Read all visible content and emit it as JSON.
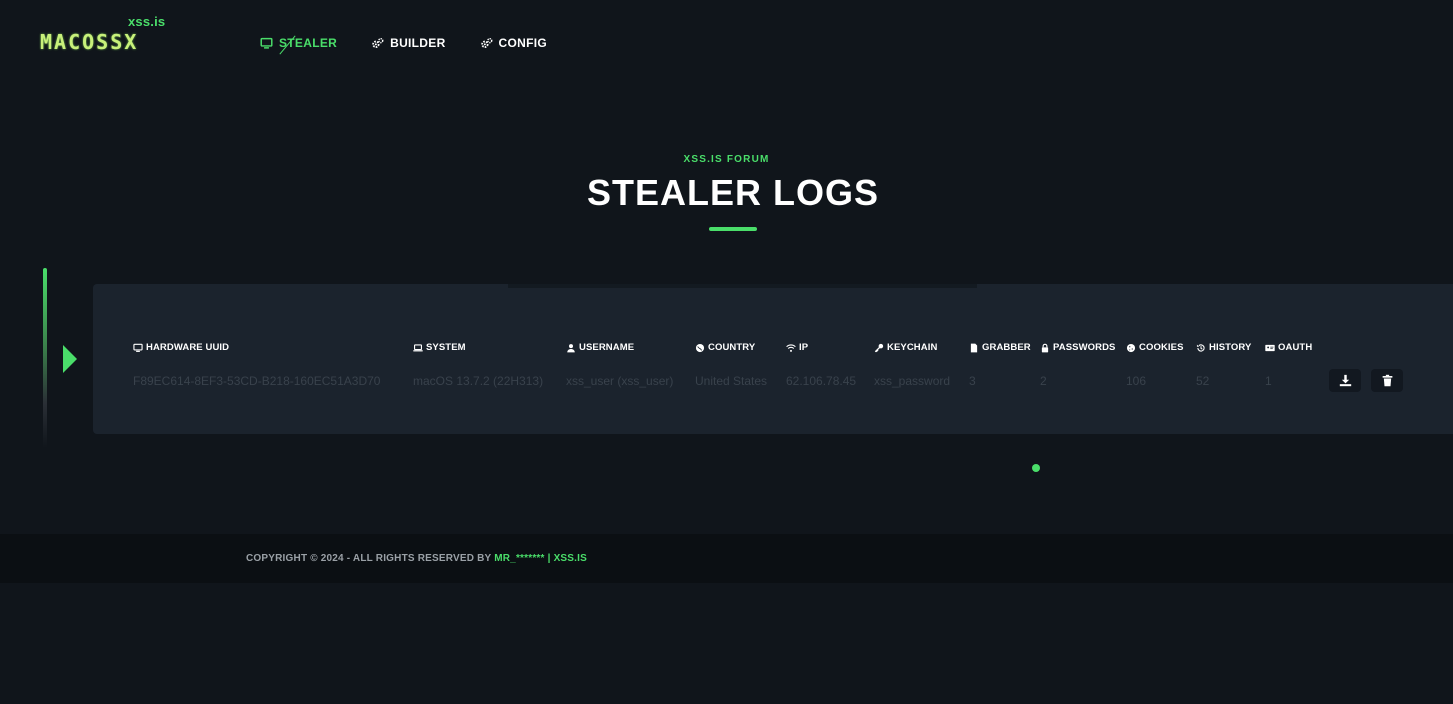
{
  "brand": {
    "sub": "xss.is",
    "name": "MACOSSX"
  },
  "nav": [
    {
      "label": "STEALER",
      "icon": "monitor-icon",
      "active": true
    },
    {
      "label": "BUILDER",
      "icon": "gears-icon",
      "active": false
    },
    {
      "label": "CONFIG",
      "icon": "gears-icon",
      "active": false
    }
  ],
  "hero": {
    "kicker": "XSS.IS FORUM",
    "title": "STEALER LOGS"
  },
  "table": {
    "headers": [
      {
        "label": "HARDWARE UUID",
        "icon": "monitor-icon"
      },
      {
        "label": "SYSTEM",
        "icon": "laptop-icon"
      },
      {
        "label": "USERNAME",
        "icon": "user-icon"
      },
      {
        "label": "COUNTRY",
        "icon": "globe-icon"
      },
      {
        "label": "IP",
        "icon": "wifi-icon"
      },
      {
        "label": "KEYCHAIN",
        "icon": "key-icon"
      },
      {
        "label": "GRABBER",
        "icon": "file-icon"
      },
      {
        "label": "PASSWORDS",
        "icon": "lock-icon"
      },
      {
        "label": "COOKIES",
        "icon": "cookie-icon"
      },
      {
        "label": "HISTORY",
        "icon": "history-icon"
      },
      {
        "label": "OAUTH",
        "icon": "id-card-icon"
      }
    ],
    "rows": [
      {
        "uuid": "F89EC614-8EF3-53CD-B218-160EC51A3D70",
        "system": "macOS 13.7.2 (22H313)",
        "username": "xss_user (xss_user)",
        "country": "United States",
        "ip": "62.106.78.45",
        "keychain": "xss_password",
        "grabber": "3",
        "passwords": "2",
        "cookies": "106",
        "history": "52",
        "oauth": "1"
      }
    ],
    "actions": [
      {
        "icon": "download-icon"
      },
      {
        "icon": "trash-icon"
      }
    ]
  },
  "footer": {
    "prefix": "COPYRIGHT © 2024 - ALL RIGHTS RESERVED BY ",
    "author": "MR_*******",
    "separator": " | ",
    "site": "XSS.IS"
  },
  "colors": {
    "accent": "#4ade6a",
    "background": "#10151b",
    "panel": "#1b232d"
  }
}
